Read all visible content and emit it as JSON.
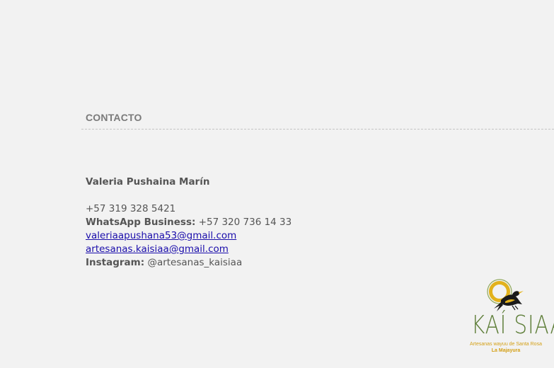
{
  "section": {
    "heading": "CONTACTO"
  },
  "contact": {
    "name": "Valeria Pushaina Marín",
    "phone": "+57 319 328 5421",
    "whatsapp_label": "WhatsApp Business:",
    "whatsapp_value": "+57 320 736 14 33",
    "email_1": "valeriaapushana53@gmail.com",
    "email_2": "artesanas.kaisiaa@gmail.com",
    "instagram_label": "Instagram:",
    "instagram_value": "@artesanas_kaisiaa"
  },
  "logo": {
    "wordmark": "KAÍ SIAA",
    "tagline": "Artesanas wayuu de Santa Rosa",
    "subline": "La Majayura",
    "colors": {
      "green": "#5f7f3a",
      "gold": "#d4a017",
      "bird": "#1a1a1a"
    }
  },
  "colors": {
    "background": "#f2f2f2",
    "text": "#555555",
    "heading": "#7a7a7a",
    "link": "#1a0dab"
  }
}
